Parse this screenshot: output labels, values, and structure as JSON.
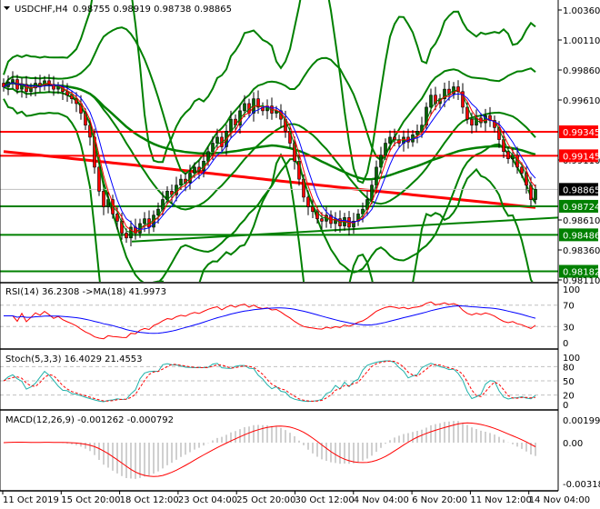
{
  "header": {
    "collapse_icon": "triangle-down-icon",
    "symbol": "USDCHF,H4",
    "ohlc": "0.98755 0.98919 0.98738 0.98865"
  },
  "colors": {
    "bull": "#006400",
    "bear": "#ff0000",
    "band": "#008000",
    "resistance": "#ff0000",
    "support": "#008000",
    "rsi": "#ff0000",
    "rsi_ma": "#0000ff",
    "stoch_main": "#20b2aa",
    "stoch_signal": "#ff0000",
    "macd": "#ff0000",
    "macd_hist": "#a0a0a0"
  },
  "chart_data": [
    {
      "type": "candlestick",
      "title": "USDCHF,H4",
      "ylim": [
        0.9811,
        1.0036
      ],
      "price_ticks": [
        "1.00360",
        "1.00110",
        "0.99860",
        "0.99610",
        "0.99110",
        "0.98610",
        "0.98360",
        "0.98110"
      ],
      "price_tick_values": [
        1.0036,
        1.0011,
        0.9986,
        0.9961,
        0.9911,
        0.9861,
        0.9836,
        0.9811
      ],
      "time_ticks": [
        "11 Oct 2019",
        "15 Oct 20:00",
        "18 Oct 12:00",
        "23 Oct 04:00",
        "25 Oct 20:00",
        "30 Oct 12:00",
        "4 Nov 04:00",
        "6 Nov 20:00",
        "11 Nov 12:00",
        "14 Nov 04:00"
      ],
      "closes": [
        0.9972,
        0.9976,
        0.9978,
        0.997,
        0.9974,
        0.9968,
        0.9971,
        0.9975,
        0.9973,
        0.9977,
        0.9974,
        0.997,
        0.9972,
        0.9968,
        0.9965,
        0.9962,
        0.9958,
        0.995,
        0.994,
        0.993,
        0.9905,
        0.9885,
        0.9872,
        0.9878,
        0.9866,
        0.986,
        0.985,
        0.9846,
        0.9855,
        0.985,
        0.9858,
        0.9862,
        0.9855,
        0.9865,
        0.987,
        0.9878,
        0.9885,
        0.9882,
        0.989,
        0.9895,
        0.9892,
        0.99,
        0.9905,
        0.9902,
        0.991,
        0.9918,
        0.9925,
        0.993,
        0.9922,
        0.9935,
        0.9945,
        0.994,
        0.9952,
        0.9958,
        0.995,
        0.9962,
        0.9955,
        0.9952,
        0.9956,
        0.995,
        0.9952,
        0.9945,
        0.9935,
        0.9925,
        0.991,
        0.9895,
        0.988,
        0.9872,
        0.9868,
        0.9862,
        0.986,
        0.9865,
        0.9858,
        0.9862,
        0.9856,
        0.9863,
        0.9855,
        0.986,
        0.9866,
        0.987,
        0.9878,
        0.989,
        0.9905,
        0.9915,
        0.9925,
        0.993,
        0.9928,
        0.9925,
        0.993,
        0.9926,
        0.9932,
        0.9935,
        0.994,
        0.9955,
        0.9965,
        0.9958,
        0.9962,
        0.997,
        0.9966,
        0.9972,
        0.9968,
        0.9955,
        0.9945,
        0.994,
        0.9946,
        0.9942,
        0.9948,
        0.9944,
        0.9938,
        0.9928,
        0.9918,
        0.9912,
        0.9915,
        0.9905,
        0.99,
        0.989,
        0.9878,
        0.98865
      ],
      "levels": [
        {
          "value": 0.99345,
          "label": "0.99345",
          "kind": "resistance"
        },
        {
          "value": 0.99145,
          "label": "0.99145",
          "kind": "resistance"
        },
        {
          "value": 0.98724,
          "label": "0.98724",
          "kind": "support"
        },
        {
          "value": 0.98486,
          "label": "0.98486",
          "kind": "support"
        },
        {
          "value": 0.98182,
          "label": "0.98182",
          "kind": "support"
        }
      ],
      "current_price": {
        "value": 0.98865,
        "label": "0.98865"
      },
      "trendline": {
        "from": 0.9843,
        "to": 0.9863
      }
    },
    {
      "type": "line",
      "title": "RSI(14) 36.2308   ->MA(18) 41.9973",
      "ylim": [
        0,
        100
      ],
      "ticks": [
        "100",
        "70",
        "30",
        "0"
      ],
      "tick_values": [
        100,
        70,
        30,
        0
      ],
      "levels": [
        70,
        30
      ]
    },
    {
      "type": "line",
      "title": "Stoch(5,3,3) 16.4029 21.4553",
      "ylim": [
        0,
        100
      ],
      "ticks": [
        "100",
        "80",
        "50",
        "20",
        "0"
      ],
      "tick_values": [
        100,
        80,
        50,
        20,
        0
      ],
      "levels": [
        80,
        50,
        20
      ]
    },
    {
      "type": "bar",
      "title": "MACD(12,26,9) -0.001262 -0.000792",
      "ylim": [
        -0.003189,
        0.001996
      ],
      "ticks": [
        "0.001996",
        "0.00",
        "-0.003189"
      ],
      "tick_values": [
        0.001996,
        0,
        -0.003189
      ]
    }
  ]
}
